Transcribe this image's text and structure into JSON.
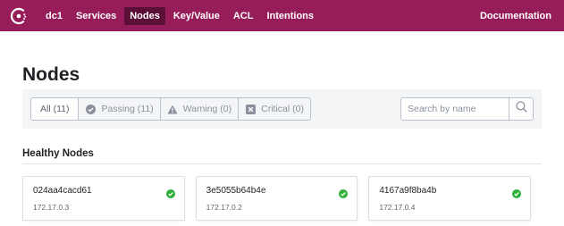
{
  "nav": {
    "datacenter": "dc1",
    "items": [
      {
        "label": "Services",
        "active": false
      },
      {
        "label": "Nodes",
        "active": true
      },
      {
        "label": "Key/Value",
        "active": false
      },
      {
        "label": "ACL",
        "active": false
      },
      {
        "label": "Intentions",
        "active": false
      }
    ],
    "documentation": "Documentation"
  },
  "page": {
    "title": "Nodes"
  },
  "filters": [
    {
      "label": "All (11)",
      "icon": "",
      "selected": true
    },
    {
      "label": "Passing (11)",
      "icon": "check-circle-icon",
      "selected": false
    },
    {
      "label": "Warning (0)",
      "icon": "warning-triangle-icon",
      "selected": false
    },
    {
      "label": "Critical (0)",
      "icon": "x-square-icon",
      "selected": false
    }
  ],
  "search": {
    "placeholder": "Search by name",
    "value": ""
  },
  "section": {
    "title": "Healthy Nodes"
  },
  "nodes": [
    {
      "name": "024aa4cacd61",
      "address": "172.17.0.3",
      "status": "passing"
    },
    {
      "name": "3e5055b64b4e",
      "address": "172.17.0.2",
      "status": "passing"
    },
    {
      "name": "4167a9f8ba4b",
      "address": "172.17.0.4",
      "status": "passing"
    }
  ],
  "colors": {
    "brand": "#961d59",
    "brand_active": "#5c0f36",
    "passing": "#2eb039"
  }
}
